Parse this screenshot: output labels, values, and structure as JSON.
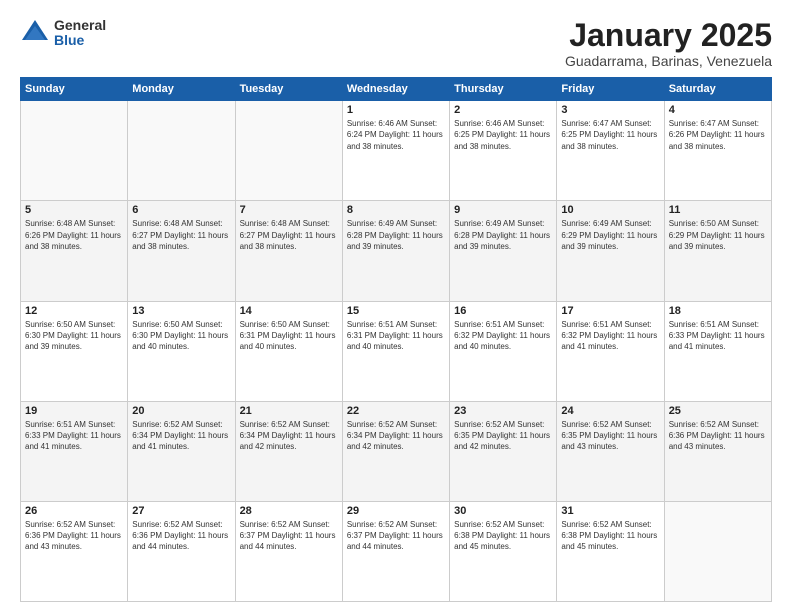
{
  "logo": {
    "general": "General",
    "blue": "Blue"
  },
  "header": {
    "month": "January 2025",
    "location": "Guadarrama, Barinas, Venezuela"
  },
  "days_of_week": [
    "Sunday",
    "Monday",
    "Tuesday",
    "Wednesday",
    "Thursday",
    "Friday",
    "Saturday"
  ],
  "weeks": [
    [
      {
        "day": "",
        "info": ""
      },
      {
        "day": "",
        "info": ""
      },
      {
        "day": "",
        "info": ""
      },
      {
        "day": "1",
        "info": "Sunrise: 6:46 AM\nSunset: 6:24 PM\nDaylight: 11 hours\nand 38 minutes."
      },
      {
        "day": "2",
        "info": "Sunrise: 6:46 AM\nSunset: 6:25 PM\nDaylight: 11 hours\nand 38 minutes."
      },
      {
        "day": "3",
        "info": "Sunrise: 6:47 AM\nSunset: 6:25 PM\nDaylight: 11 hours\nand 38 minutes."
      },
      {
        "day": "4",
        "info": "Sunrise: 6:47 AM\nSunset: 6:26 PM\nDaylight: 11 hours\nand 38 minutes."
      }
    ],
    [
      {
        "day": "5",
        "info": "Sunrise: 6:48 AM\nSunset: 6:26 PM\nDaylight: 11 hours\nand 38 minutes."
      },
      {
        "day": "6",
        "info": "Sunrise: 6:48 AM\nSunset: 6:27 PM\nDaylight: 11 hours\nand 38 minutes."
      },
      {
        "day": "7",
        "info": "Sunrise: 6:48 AM\nSunset: 6:27 PM\nDaylight: 11 hours\nand 38 minutes."
      },
      {
        "day": "8",
        "info": "Sunrise: 6:49 AM\nSunset: 6:28 PM\nDaylight: 11 hours\nand 39 minutes."
      },
      {
        "day": "9",
        "info": "Sunrise: 6:49 AM\nSunset: 6:28 PM\nDaylight: 11 hours\nand 39 minutes."
      },
      {
        "day": "10",
        "info": "Sunrise: 6:49 AM\nSunset: 6:29 PM\nDaylight: 11 hours\nand 39 minutes."
      },
      {
        "day": "11",
        "info": "Sunrise: 6:50 AM\nSunset: 6:29 PM\nDaylight: 11 hours\nand 39 minutes."
      }
    ],
    [
      {
        "day": "12",
        "info": "Sunrise: 6:50 AM\nSunset: 6:30 PM\nDaylight: 11 hours\nand 39 minutes."
      },
      {
        "day": "13",
        "info": "Sunrise: 6:50 AM\nSunset: 6:30 PM\nDaylight: 11 hours\nand 40 minutes."
      },
      {
        "day": "14",
        "info": "Sunrise: 6:50 AM\nSunset: 6:31 PM\nDaylight: 11 hours\nand 40 minutes."
      },
      {
        "day": "15",
        "info": "Sunrise: 6:51 AM\nSunset: 6:31 PM\nDaylight: 11 hours\nand 40 minutes."
      },
      {
        "day": "16",
        "info": "Sunrise: 6:51 AM\nSunset: 6:32 PM\nDaylight: 11 hours\nand 40 minutes."
      },
      {
        "day": "17",
        "info": "Sunrise: 6:51 AM\nSunset: 6:32 PM\nDaylight: 11 hours\nand 41 minutes."
      },
      {
        "day": "18",
        "info": "Sunrise: 6:51 AM\nSunset: 6:33 PM\nDaylight: 11 hours\nand 41 minutes."
      }
    ],
    [
      {
        "day": "19",
        "info": "Sunrise: 6:51 AM\nSunset: 6:33 PM\nDaylight: 11 hours\nand 41 minutes."
      },
      {
        "day": "20",
        "info": "Sunrise: 6:52 AM\nSunset: 6:34 PM\nDaylight: 11 hours\nand 41 minutes."
      },
      {
        "day": "21",
        "info": "Sunrise: 6:52 AM\nSunset: 6:34 PM\nDaylight: 11 hours\nand 42 minutes."
      },
      {
        "day": "22",
        "info": "Sunrise: 6:52 AM\nSunset: 6:34 PM\nDaylight: 11 hours\nand 42 minutes."
      },
      {
        "day": "23",
        "info": "Sunrise: 6:52 AM\nSunset: 6:35 PM\nDaylight: 11 hours\nand 42 minutes."
      },
      {
        "day": "24",
        "info": "Sunrise: 6:52 AM\nSunset: 6:35 PM\nDaylight: 11 hours\nand 43 minutes."
      },
      {
        "day": "25",
        "info": "Sunrise: 6:52 AM\nSunset: 6:36 PM\nDaylight: 11 hours\nand 43 minutes."
      }
    ],
    [
      {
        "day": "26",
        "info": "Sunrise: 6:52 AM\nSunset: 6:36 PM\nDaylight: 11 hours\nand 43 minutes."
      },
      {
        "day": "27",
        "info": "Sunrise: 6:52 AM\nSunset: 6:36 PM\nDaylight: 11 hours\nand 44 minutes."
      },
      {
        "day": "28",
        "info": "Sunrise: 6:52 AM\nSunset: 6:37 PM\nDaylight: 11 hours\nand 44 minutes."
      },
      {
        "day": "29",
        "info": "Sunrise: 6:52 AM\nSunset: 6:37 PM\nDaylight: 11 hours\nand 44 minutes."
      },
      {
        "day": "30",
        "info": "Sunrise: 6:52 AM\nSunset: 6:38 PM\nDaylight: 11 hours\nand 45 minutes."
      },
      {
        "day": "31",
        "info": "Sunrise: 6:52 AM\nSunset: 6:38 PM\nDaylight: 11 hours\nand 45 minutes."
      },
      {
        "day": "",
        "info": ""
      }
    ]
  ]
}
